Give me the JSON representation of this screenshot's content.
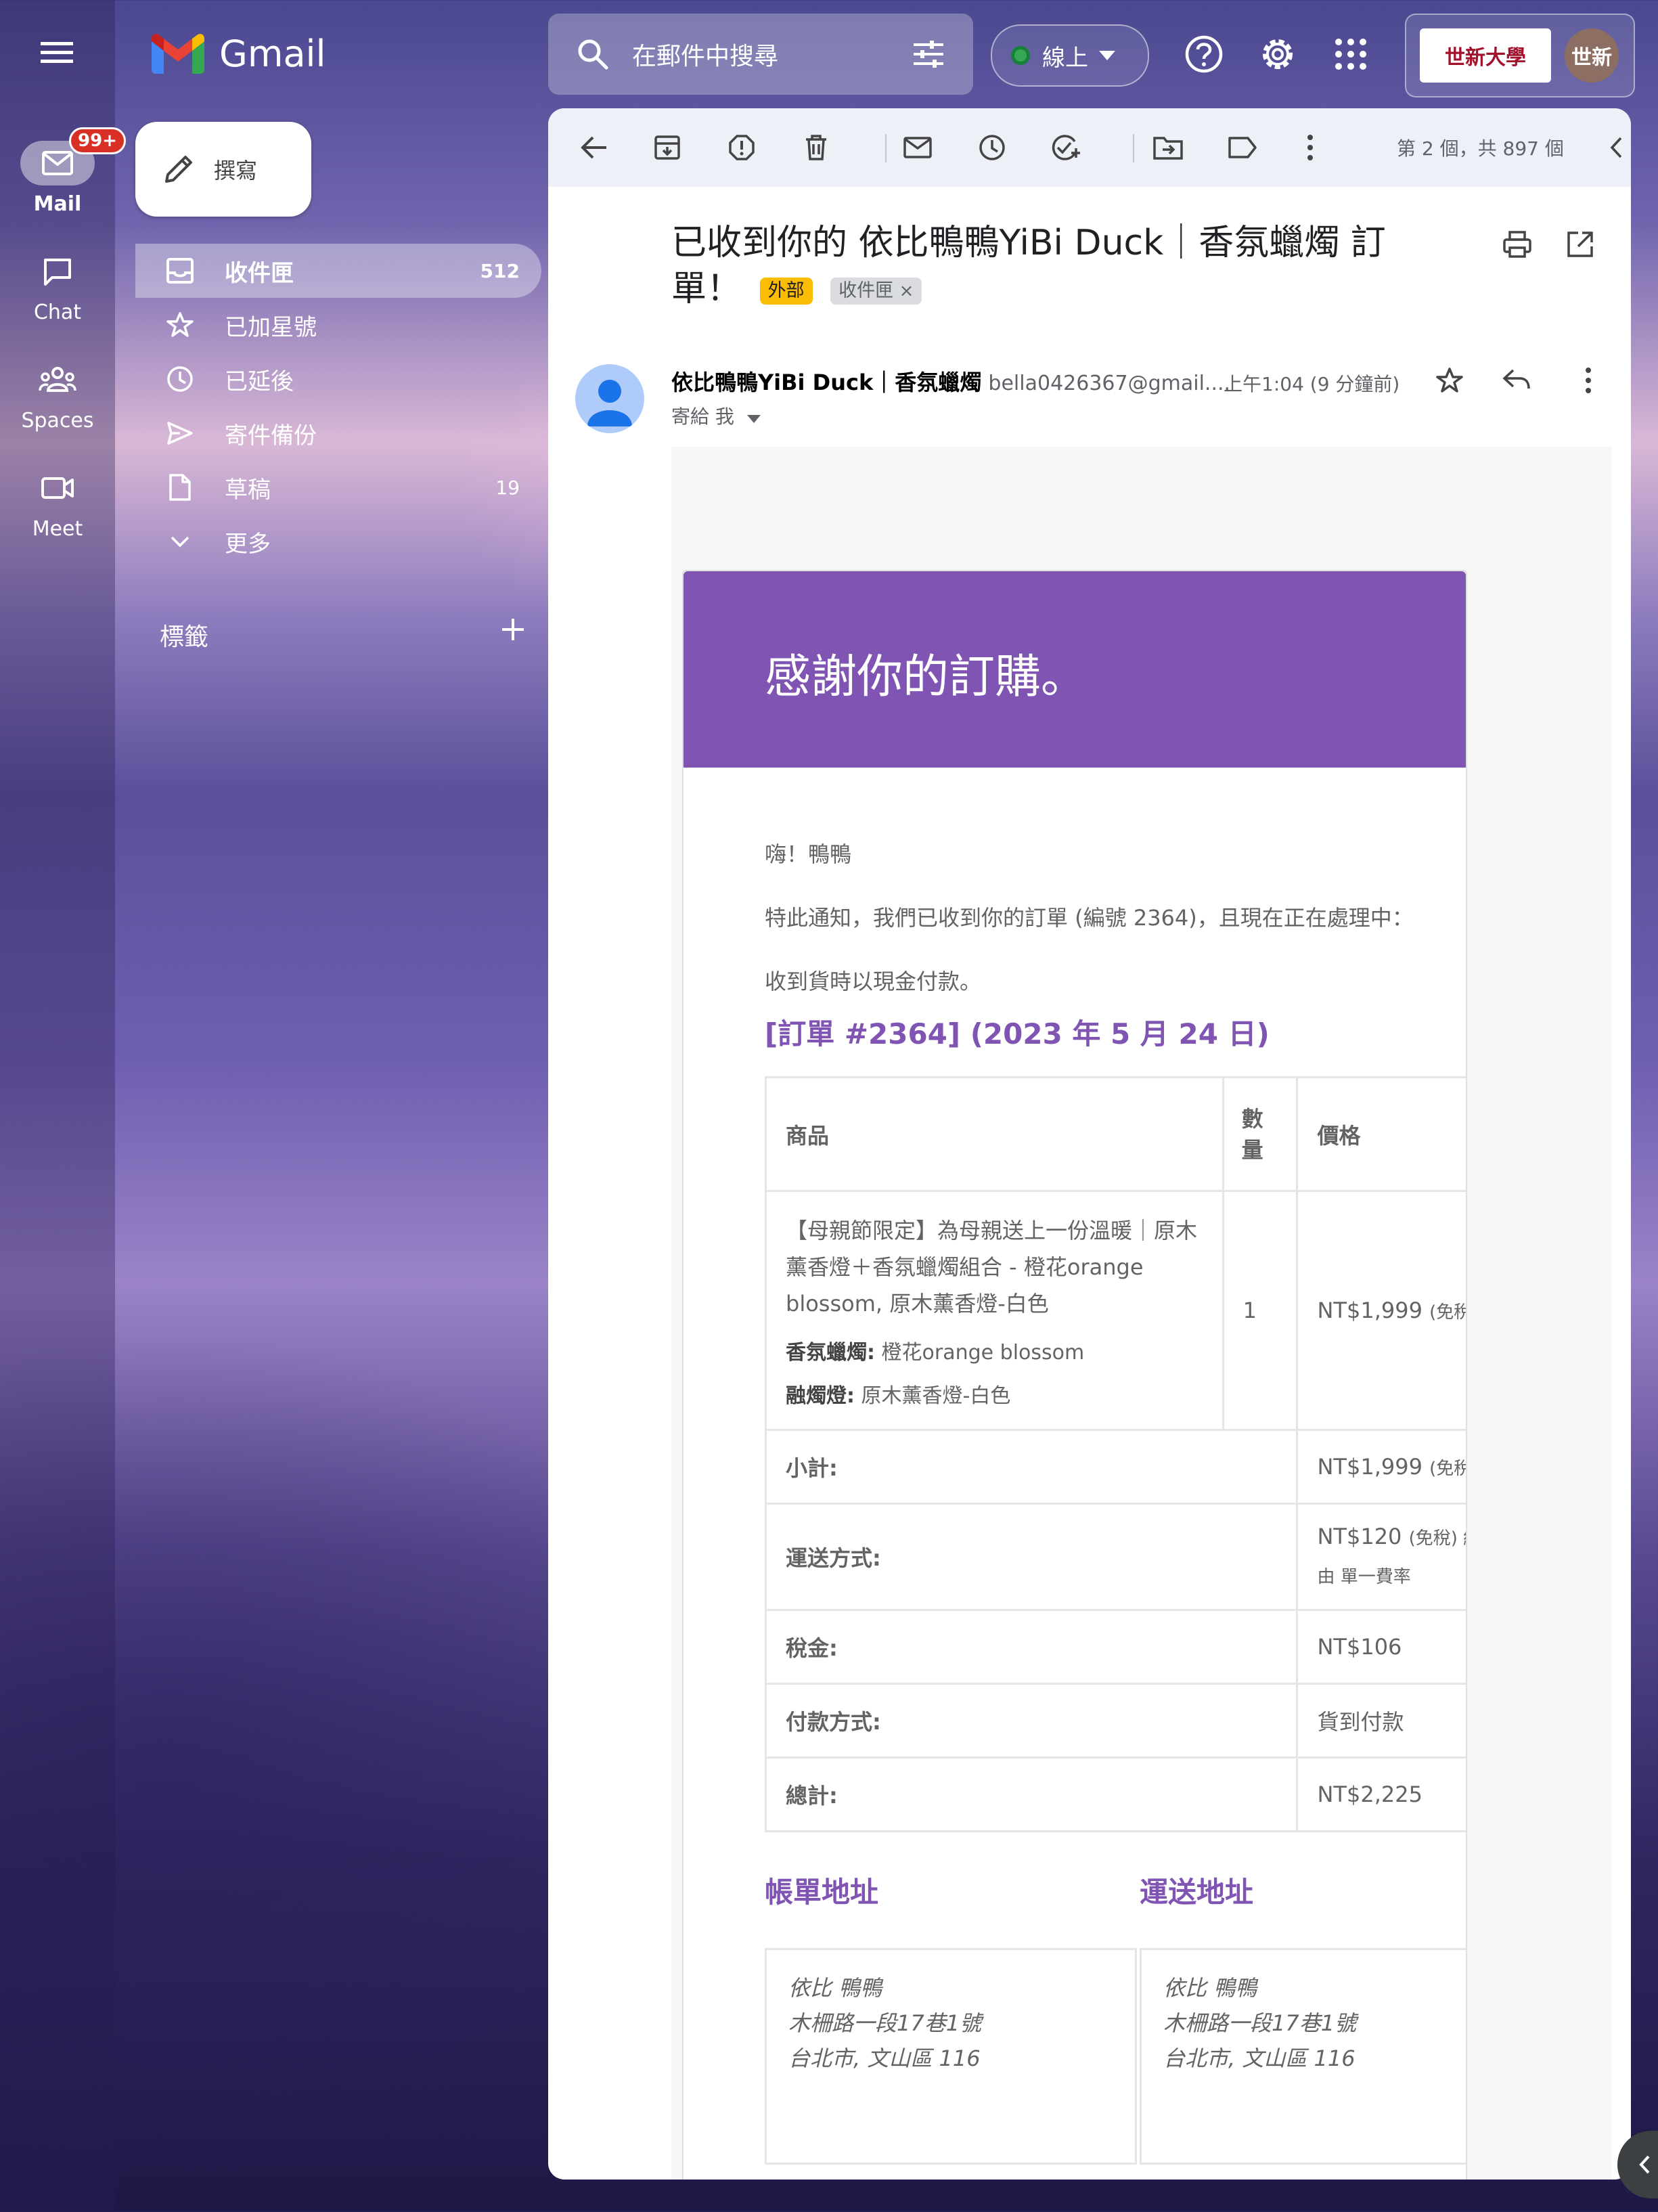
{
  "app": {
    "name": "Gmail"
  },
  "rail": {
    "items": [
      {
        "label": "Mail",
        "badge": "99+"
      },
      {
        "label": "Chat"
      },
      {
        "label": "Spaces"
      },
      {
        "label": "Meet"
      }
    ]
  },
  "search": {
    "placeholder": "在郵件中搜尋"
  },
  "status": {
    "label": "線上"
  },
  "account": {
    "org_name": "世新大學",
    "avatar_text": "世新"
  },
  "compose": {
    "label": "撰寫"
  },
  "sidebar": {
    "items": [
      {
        "label": "收件匣",
        "count": "512"
      },
      {
        "label": "已加星號"
      },
      {
        "label": "已延後"
      },
      {
        "label": "寄件備份"
      },
      {
        "label": "草稿",
        "count": "19"
      },
      {
        "label": "更多"
      }
    ],
    "labels_title": "標籤"
  },
  "toolbar": {
    "pager": "第 2 個，共 897 個"
  },
  "message": {
    "subject": "已收到你的 依比鴨鴨YiBi Duck｜香氛蠟燭 訂單！",
    "chip_external": "外部",
    "chip_inbox": "收件匣",
    "sender_name": "依比鴨鴨YiBi Duck｜香氛蠟燭",
    "sender_email": "bella0426367@gmail....",
    "time": "上午1:04 (9 分鐘前)",
    "to": "寄給 我"
  },
  "email": {
    "heading": "感謝你的訂購。",
    "greeting": "嗨！鴨鴨",
    "notice": "特此通知，我們已收到你的訂單 (編號 2364)，且現在正在處理中：",
    "payment_note": "收到貨時以現金付款。",
    "order_title": "[訂單 #2364] (2023 年 5 月 24 日)",
    "table": {
      "headers": {
        "product": "商品",
        "qty": "數量",
        "price": "價格"
      },
      "item": {
        "name": "【母親節限定】為母親送上一份溫暖｜原木薰香燈＋香氛蠟燭組合 - 橙花orange blossom, 原木薰香燈-白色",
        "meta1_key": "香氛蠟燭:",
        "meta1_val": "橙花orange blossom",
        "meta2_key": "融燭燈:",
        "meta2_val": "原木薰香燈-白色",
        "qty": "1",
        "price": "NT$1,999",
        "price_note": "(免稅)"
      },
      "rows": [
        {
          "label": "小計:",
          "value": "NT$1,999",
          "note": "(免稅)"
        },
        {
          "label": "運送方式:",
          "value": "NT$120",
          "note": "(免稅) 經由 單一費率"
        },
        {
          "label": "稅金:",
          "value": "NT$106"
        },
        {
          "label": "付款方式:",
          "value": "貨到付款"
        },
        {
          "label": "總計:",
          "value": "NT$2,225"
        }
      ]
    },
    "billing": {
      "title": "帳單地址",
      "lines": [
        "依比 鴨鴨",
        "木柵路一段17巷1號",
        "台北市, 文山區 116"
      ]
    },
    "shipping": {
      "title": "運送地址",
      "lines": [
        "依比 鴨鴨",
        "木柵路一段17巷1號",
        "台北市, 文山區 116"
      ]
    }
  },
  "colors": {
    "accent": "#7f54b3",
    "gmail_red": "#d93025",
    "online_green": "#34a853"
  }
}
